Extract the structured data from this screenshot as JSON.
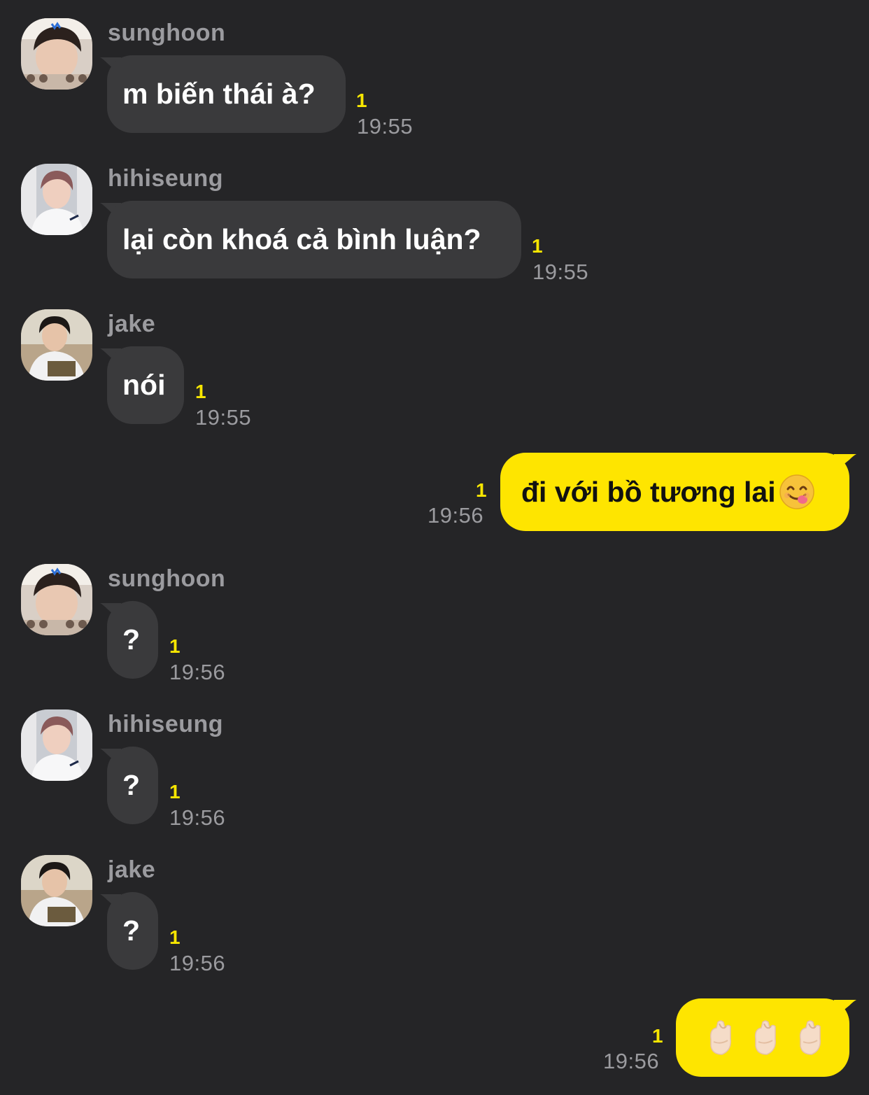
{
  "messages": [
    {
      "type": "in",
      "sender": "sunghoon",
      "avatar": "sunghoon-avatar",
      "text": "m biến thái à?",
      "unread": "1",
      "time": "19:55"
    },
    {
      "type": "in",
      "sender": "hihiseung",
      "avatar": "hihiseung-avatar",
      "text": "lại còn khoá cả bình luận?",
      "unread": "1",
      "time": "19:55"
    },
    {
      "type": "in",
      "sender": "jake",
      "avatar": "jake-avatar",
      "text": "nói",
      "unread": "1",
      "time": "19:55"
    },
    {
      "type": "out",
      "text": "đi với bồ tương lai",
      "emoji": "face-savoring-food-emoji",
      "unread": "1",
      "time": "19:56"
    },
    {
      "type": "in",
      "sender": "sunghoon",
      "avatar": "sunghoon-avatar",
      "text": "?",
      "unread": "1",
      "time": "19:56"
    },
    {
      "type": "in",
      "sender": "hihiseung",
      "avatar": "hihiseung-avatar",
      "text": "?",
      "unread": "1",
      "time": "19:56"
    },
    {
      "type": "in",
      "sender": "jake",
      "avatar": "jake-avatar",
      "text": "?",
      "unread": "1",
      "time": "19:56"
    },
    {
      "type": "out",
      "text": "",
      "emoji": "crossed-fingers-emoji x3",
      "unread": "1",
      "time": "19:56"
    }
  ],
  "colors": {
    "background": "#252527",
    "incoming_bubble": "#3a3a3c",
    "outgoing_bubble": "#fee500",
    "unread_count": "#f7e600",
    "meta_text": "#9b9b9f"
  }
}
